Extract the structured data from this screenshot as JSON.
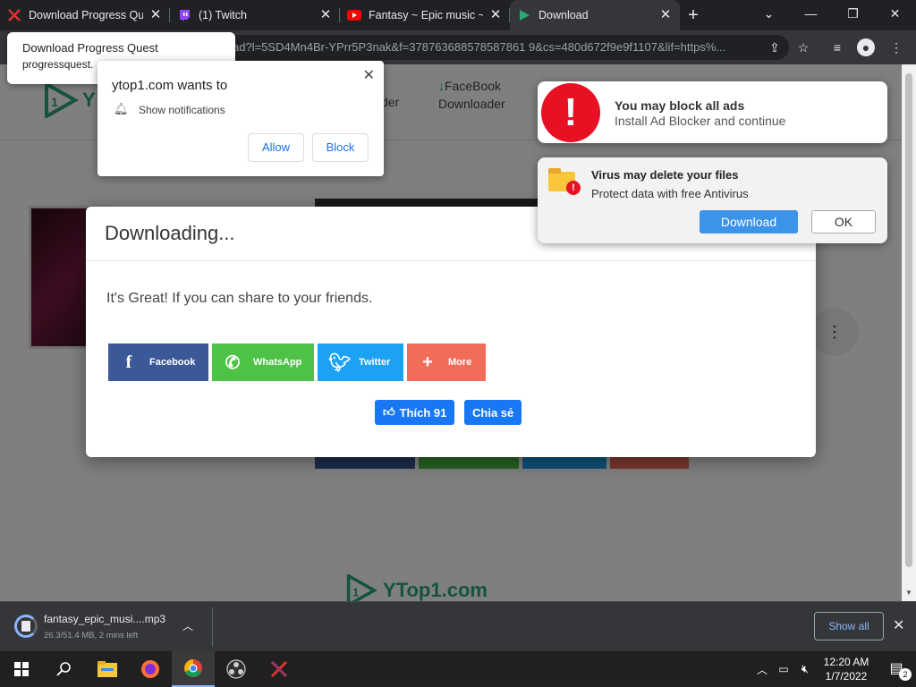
{
  "tabs": [
    {
      "title": "Download Progress Qu",
      "icon": "progress-quest-icon",
      "active": false
    },
    {
      "title": "(1) Twitch",
      "icon": "twitch-icon",
      "active": false
    },
    {
      "title": "Fantasy ~ Epic music ~",
      "icon": "youtube-icon",
      "active": false
    },
    {
      "title": "Download",
      "icon": "ytop1-icon",
      "active": true
    }
  ],
  "url": "ad?l=5SD4Mn4Br-YPrr5P3nak&f=378763688578587861 9&cs=480d672f9e9f1107&lif=https%...",
  "tooltip": {
    "title": "Download Progress Quest",
    "domain": "progressquest."
  },
  "site": {
    "logo": "YTop1.com",
    "nav_fb_line1": "FaceBook",
    "nav_fb_line2": "Downloader",
    "nav_partial": "der"
  },
  "notification": {
    "title": "ytop1.com wants to",
    "item": "Show notifications",
    "allow": "Allow",
    "block": "Block"
  },
  "modal": {
    "title": "Downloading...",
    "message": "It's Great! If you can share to your friends.",
    "share": [
      {
        "label": "Facebook",
        "color": "#3b5998"
      },
      {
        "label": "WhatsApp",
        "color": "#4dc247"
      },
      {
        "label": "Twitter",
        "color": "#1da1f2"
      },
      {
        "label": "More",
        "color": "#f26c5a"
      }
    ],
    "like_label": "Thích 91",
    "share_label": "Chia sẻ"
  },
  "ad1": {
    "title": "You may block all ads",
    "subtitle": "Install Ad Blocker and continue"
  },
  "ad2": {
    "title": "Virus may delete your files",
    "subtitle": "Protect data with free Antivirus",
    "download": "Download",
    "ok": "OK"
  },
  "download": {
    "filename": "fantasy_epic_musi....mp3",
    "status": "26.3/51.4 MB, 2 mins left",
    "show_all": "Show all"
  },
  "clock": {
    "time": "12:20 AM",
    "date": "1/7/2022",
    "notif_count": "2"
  },
  "colors": {
    "accent": "#1a73e8",
    "alert_red": "#e81123",
    "logo_green": "#2aa876"
  }
}
